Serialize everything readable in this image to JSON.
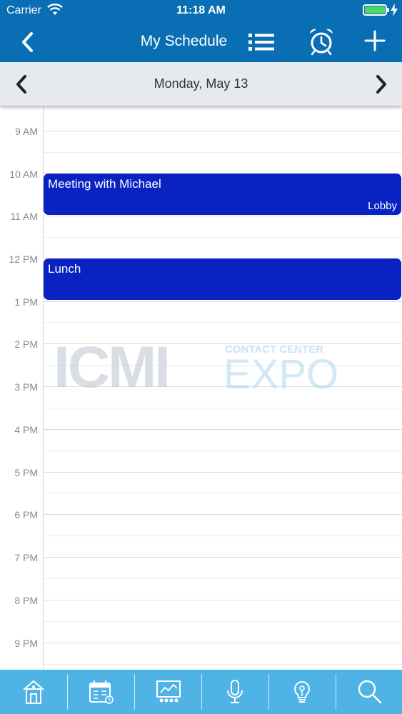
{
  "status_bar": {
    "carrier": "Carrier",
    "time": "11:18 AM"
  },
  "nav": {
    "title": "My Schedule"
  },
  "date_bar": {
    "date": "Monday, May 13"
  },
  "calendar": {
    "hours": [
      "9 AM",
      "10 AM",
      "11 AM",
      "12 PM",
      "1 PM",
      "2 PM",
      "3 PM",
      "4 PM",
      "5 PM",
      "6 PM",
      "7 PM",
      "8 PM",
      "9 PM"
    ],
    "events": [
      {
        "title": "Meeting with Michael",
        "location": "Lobby",
        "start": "10:00 AM",
        "end": "11:00 AM"
      },
      {
        "title": "Lunch",
        "location": "",
        "start": "12:00 PM",
        "end": "1:00 PM"
      }
    ]
  },
  "watermark": {
    "brand": "ICMI",
    "line1": "CONTACT CENTER",
    "line2": "EXPO"
  },
  "colors": {
    "nav": "#0a6eb4",
    "event": "#0a22c2",
    "tab_bar": "#4fb3e6",
    "date_bar": "#e6e9ee"
  },
  "tab_bar": {
    "tabs": [
      {
        "icon": "home-icon"
      },
      {
        "icon": "calendar-icon"
      },
      {
        "icon": "presentation-icon"
      },
      {
        "icon": "microphone-icon"
      },
      {
        "icon": "lightbulb-icon"
      },
      {
        "icon": "search-icon"
      }
    ]
  }
}
